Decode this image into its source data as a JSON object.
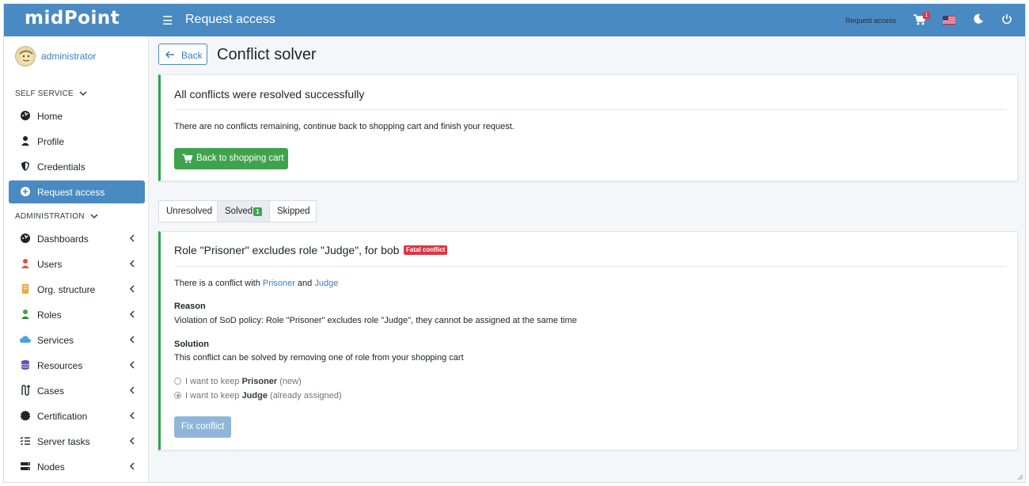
{
  "app": {
    "brand": "midPoint",
    "page_title": "Request access"
  },
  "header": {
    "breadcrumb_link": "Request access",
    "cart_count": "1",
    "icons": [
      "menu-icon",
      "cart-icon",
      "us-flag-icon",
      "moon-icon",
      "power-icon"
    ]
  },
  "sidebar": {
    "user": "administrator",
    "self_service_label": "SELF SERVICE",
    "self_service_items": [
      {
        "label": "Home",
        "icon": "dashboard-icon"
      },
      {
        "label": "Profile",
        "icon": "user-icon"
      },
      {
        "label": "Credentials",
        "icon": "shield-icon"
      },
      {
        "label": "Request access",
        "icon": "plus-circle-icon",
        "active": true
      }
    ],
    "administration_label": "ADMINISTRATION",
    "admin_items": [
      {
        "label": "Dashboards",
        "icon": "dashboard-icon"
      },
      {
        "label": "Users",
        "icon": "user-icon"
      },
      {
        "label": "Org. structure",
        "icon": "building-icon"
      },
      {
        "label": "Roles",
        "icon": "role-icon"
      },
      {
        "label": "Services",
        "icon": "cloud-icon"
      },
      {
        "label": "Resources",
        "icon": "database-icon"
      },
      {
        "label": "Cases",
        "icon": "cases-icon"
      },
      {
        "label": "Certification",
        "icon": "certificate-icon"
      },
      {
        "label": "Server tasks",
        "icon": "tasks-icon"
      },
      {
        "label": "Nodes",
        "icon": "server-icon"
      }
    ]
  },
  "main": {
    "back_label": "Back",
    "title": "Conflict solver",
    "success_card": {
      "title": "All conflicts were resolved successfully",
      "text": "There are no conflicts remaining, continue back to shopping cart and finish your request.",
      "button": "Back to shopping cart"
    },
    "tabs": [
      {
        "label": "Unresolved"
      },
      {
        "label": "Solved",
        "badge": "1",
        "selected": true
      },
      {
        "label": "Skipped"
      }
    ],
    "conflict": {
      "title": "Role \"Prisoner\" excludes role \"Judge\", for bob",
      "badge": "Fatal conflict",
      "intro_prefix": "There is a conflict with",
      "link1": "Prisoner",
      "intro_and": "and",
      "link2": "Judge",
      "reason_label": "Reason",
      "reason_text": "Violation of SoD policy: Role \"Prisoner\" excludes role \"Judge\", they cannot be assigned at the same time",
      "solution_label": "Solution",
      "solution_text": "This conflict can be solved by removing one of role from your shopping cart",
      "option1": {
        "prefix": "I want to keep",
        "name": "Prisoner",
        "suffix": "(new)",
        "checked": false
      },
      "option2": {
        "prefix": "I want to keep",
        "name": "Judge",
        "suffix": "(already assigned)",
        "checked": true
      },
      "fix_button": "Fix conflict"
    }
  },
  "colors": {
    "header": "#4a8ac2",
    "success": "#3fa34d",
    "danger": "#dc3545",
    "link": "#3a7dbf"
  }
}
